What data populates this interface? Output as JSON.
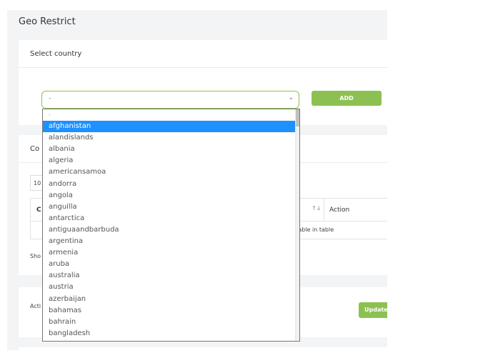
{
  "page": {
    "title": "Geo Restrict"
  },
  "select_card": {
    "title": "Select country",
    "select_value": "-",
    "add_label": "ADD"
  },
  "list_card": {
    "title_fragment": "Co",
    "length_value": "10",
    "table": {
      "first_header_fragment": "C",
      "sort_icon": "↑↓",
      "action_header": "Action",
      "empty_fragment": "ailable in table"
    },
    "info_fragment": "Sho"
  },
  "action_card": {
    "label_fragment": "Acti",
    "update_fragment": "Update"
  },
  "dropdown": {
    "selected_index": 1,
    "options": [
      "-",
      "afghanistan",
      "alandislands",
      "albania",
      "algeria",
      "americansamoa",
      "andorra",
      "angola",
      "anguilla",
      "antarctica",
      "antiguaandbarbuda",
      "argentina",
      "armenia",
      "aruba",
      "australia",
      "austria",
      "azerbaijan",
      "bahamas",
      "bahrain",
      "bangladesh"
    ]
  },
  "colors": {
    "accent": "#8cc152",
    "selection": "#1e90ff",
    "panel_bg": "#f3f4f6"
  },
  "icons": {
    "select_chevron": "chevron-down-icon",
    "sort": "sort-icon"
  }
}
